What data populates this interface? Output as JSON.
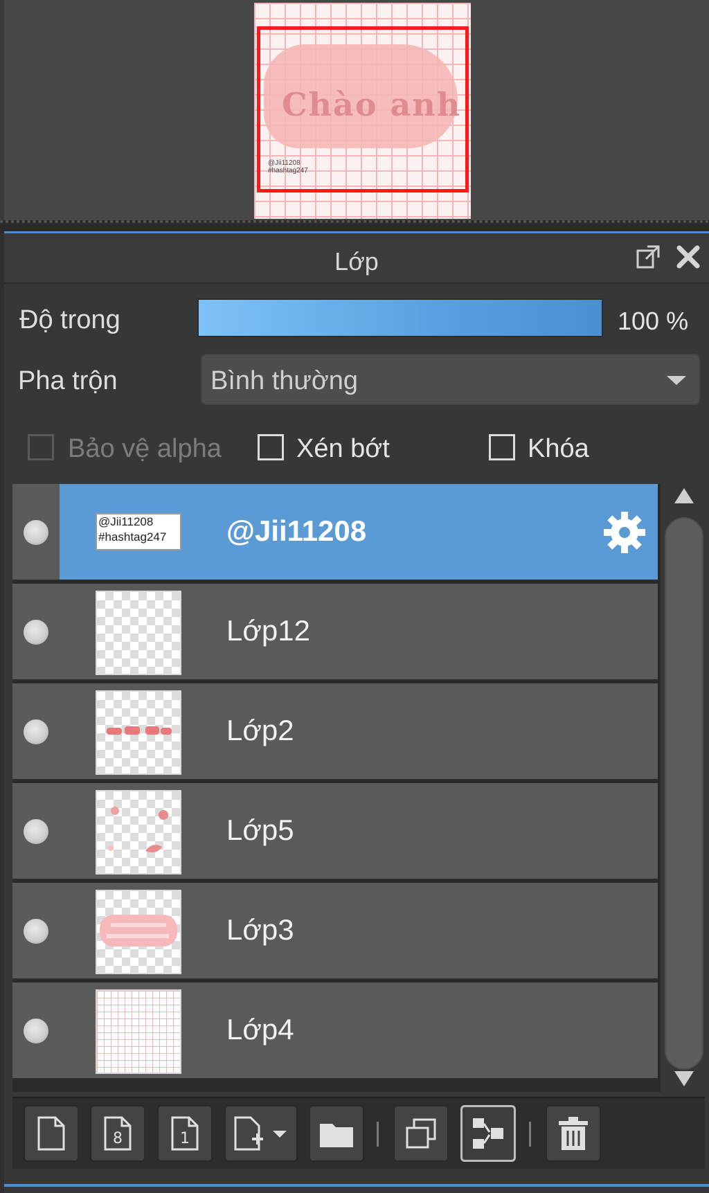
{
  "navigator": {
    "artwork_text": "Chào anh",
    "artwork_small_text": [
      "@Jii11208",
      "#hashtag247"
    ]
  },
  "panel": {
    "title": "Lớp",
    "opacity_label": "Độ trong",
    "opacity_value": "100 %",
    "opacity_fraction": 1.0,
    "blend_label": "Pha trộn",
    "blend_value": "Bình thường",
    "options": {
      "protect_alpha": {
        "label": "Bảo vệ alpha",
        "checked": false,
        "enabled": false
      },
      "clipping": {
        "label": "Xén bớt",
        "checked": false,
        "enabled": true
      },
      "lock": {
        "label": "Khóa",
        "checked": false,
        "enabled": true
      }
    }
  },
  "layers": [
    {
      "name": "@Jii11208",
      "selected": true,
      "thumb": "text",
      "thumb_text": [
        "@Jii11208",
        "#hashtag247"
      ]
    },
    {
      "name": "Lớp12",
      "selected": false,
      "thumb": "empty"
    },
    {
      "name": "Lớp2",
      "selected": false,
      "thumb": "lettering"
    },
    {
      "name": "Lớp5",
      "selected": false,
      "thumb": "doodles"
    },
    {
      "name": "Lớp3",
      "selected": false,
      "thumb": "blob"
    },
    {
      "name": "Lớp4",
      "selected": false,
      "thumb": "grid"
    }
  ],
  "toolbar": [
    "new-layer-icon",
    "new-8bit-layer-icon",
    "new-1bit-layer-icon",
    "add-layer-menu-icon",
    "folder-icon",
    "duplicate-layer-icon",
    "merge-down-icon",
    "trash-icon"
  ],
  "colors": {
    "selected_row": "#5b9bd5",
    "row": "#5a5a5a",
    "accent_blue": "#4a8fd1",
    "frame_red": "#ff1a1a"
  }
}
